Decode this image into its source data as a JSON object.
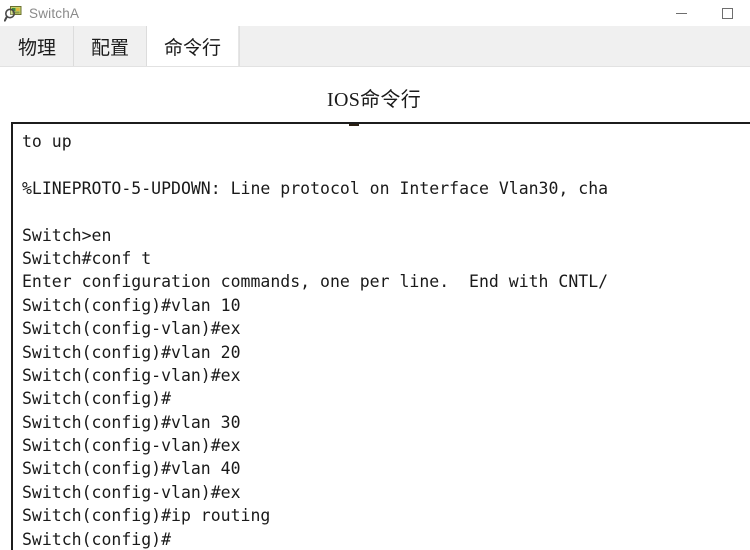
{
  "window": {
    "title": "SwitchA",
    "icon": "packet-tracer-device-icon",
    "controls": {
      "minimize": "minimize",
      "maximize": "maximize"
    }
  },
  "tabs": [
    {
      "label": "物理",
      "name": "tab-physical",
      "active": false
    },
    {
      "label": "配置",
      "name": "tab-config",
      "active": false
    },
    {
      "label": "命令行",
      "name": "tab-cli",
      "active": true
    }
  ],
  "main": {
    "heading": "IOS命令行"
  },
  "terminal": {
    "lines": [
      "to up",
      "",
      "%LINEPROTO-5-UPDOWN: Line protocol on Interface Vlan30, cha",
      "",
      "Switch>en",
      "Switch#conf t",
      "Enter configuration commands, one per line.  End with CNTL/",
      "Switch(config)#vlan 10",
      "Switch(config-vlan)#ex",
      "Switch(config)#vlan 20",
      "Switch(config-vlan)#ex",
      "Switch(config)#",
      "Switch(config)#vlan 30",
      "Switch(config-vlan)#ex",
      "Switch(config)#vlan 40",
      "Switch(config-vlan)#ex",
      "Switch(config)#ip routing",
      "Switch(config)#"
    ]
  },
  "colors": {
    "tabstrip_bg": "#f0f0f0",
    "active_tab_bg": "#ffffff",
    "terminal_border": "#1c1c1c",
    "terminal_bg": "#ffffff",
    "text": "#1a1a1a",
    "title_text": "#8a8a8a"
  }
}
